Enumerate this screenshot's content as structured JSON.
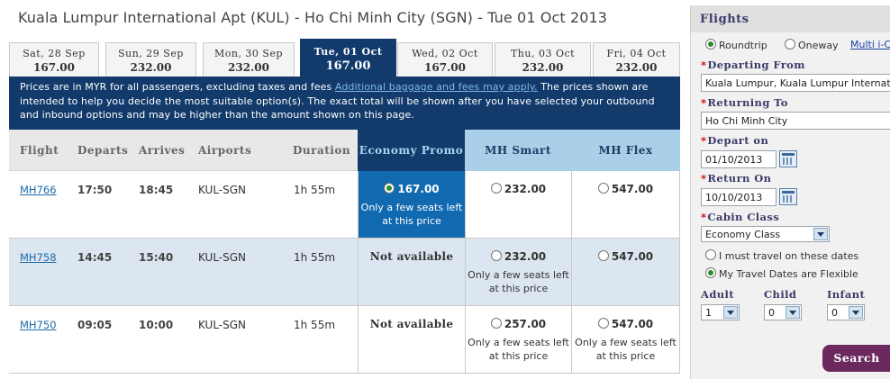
{
  "route_title": "Kuala Lumpur International Apt (KUL) - Ho Chi Minh City (SGN) - Tue 01 Oct 2013",
  "date_tabs": [
    {
      "label": "Sat, 28 Sep",
      "price": "167.00"
    },
    {
      "label": "Sun, 29 Sep",
      "price": "232.00"
    },
    {
      "label": "Mon, 30 Sep",
      "price": "232.00"
    },
    {
      "label": "Tue, 01 Oct",
      "price": "167.00"
    },
    {
      "label": "Wed, 02 Oct",
      "price": "167.00"
    },
    {
      "label": "Thu, 03 Oct",
      "price": "232.00"
    },
    {
      "label": "Fri, 04 Oct",
      "price": "232.00"
    }
  ],
  "info": {
    "text_before": "Prices are in MYR for all passengers, excluding taxes and fees ",
    "link": "Additional baggage and fees may apply.",
    "text_after": " The prices shown are intended to help you decide the most suitable option(s). The exact total will be shown after you have selected your outbound and inbound options and may be higher than the amount shown on this page."
  },
  "columns": {
    "flight": "Flight",
    "departs": "Departs",
    "arrives": "Arrives",
    "airports": "Airports",
    "duration": "Duration",
    "promo": "Economy Promo",
    "smart": "MH Smart",
    "flex": "MH Flex"
  },
  "flights": [
    {
      "flight": "MH766",
      "departs": "17:50",
      "arrives": "18:45",
      "airports": "KUL-SGN",
      "duration": "1h 55m",
      "promo": {
        "price": "167.00",
        "note": "Only a few seats left at this price"
      },
      "smart": {
        "price": "232.00",
        "note": ""
      },
      "flex": {
        "price": "547.00",
        "note": ""
      }
    },
    {
      "flight": "MH758",
      "departs": "14:45",
      "arrives": "15:40",
      "airports": "KUL-SGN",
      "duration": "1h 55m",
      "promo": {
        "na": "Not available"
      },
      "smart": {
        "price": "232.00",
        "note": "Only a few seats left at this price"
      },
      "flex": {
        "price": "547.00",
        "note": ""
      }
    },
    {
      "flight": "MH750",
      "departs": "09:05",
      "arrives": "10:00",
      "airports": "KUL-SGN",
      "duration": "1h 55m",
      "promo": {
        "na": "Not available"
      },
      "smart": {
        "price": "257.00",
        "note": "Only a few seats left at this price"
      },
      "flex": {
        "price": "547.00",
        "note": "Only a few seats left at this price"
      }
    }
  ],
  "panel": {
    "title": "Flights",
    "trip_roundtrip": "Roundtrip",
    "trip_oneway": "Oneway",
    "trip_multi": "Multi i-City",
    "departing_label": "Departing From",
    "departing_value": "Kuala Lumpur, Kuala Lumpur International",
    "returning_label": "Returning To",
    "returning_value": "Ho Chi Minh City",
    "depart_on_label": "Depart on",
    "depart_on_value": "01/10/2013",
    "return_on_label": "Return On",
    "return_on_value": "10/10/2013",
    "cabin_label": "Cabin Class",
    "cabin_value": "Economy Class",
    "must_travel": "I must travel on these dates",
    "flexible": "My Travel Dates are Flexible",
    "adult_label": "Adult",
    "child_label": "Child",
    "infant_label": "Infant",
    "adult_value": "1",
    "child_value": "0",
    "infant_value": "0",
    "search": "Search"
  },
  "colors": {
    "navy": "#123a6b",
    "selected_cell": "#1169b0",
    "light_blue_header": "#a9cfe9",
    "search_button": "#6b2960"
  }
}
